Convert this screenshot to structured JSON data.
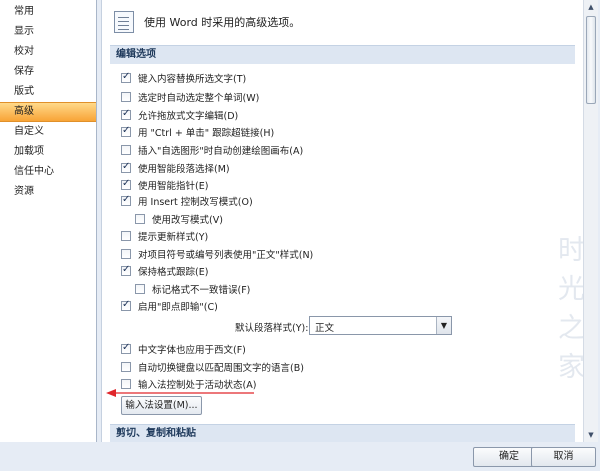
{
  "sidebar": {
    "items": [
      {
        "label": "常用"
      },
      {
        "label": "显示"
      },
      {
        "label": "校对"
      },
      {
        "label": "保存"
      },
      {
        "label": "版式"
      },
      {
        "label": "高级"
      },
      {
        "label": "自定义"
      },
      {
        "label": "加载项"
      },
      {
        "label": "信任中心"
      },
      {
        "label": "资源"
      }
    ],
    "active_index": 5
  },
  "header": {
    "title": "使用 Word 时采用的高级选项。",
    "icon": "document-options-icon"
  },
  "sections": {
    "editing": "编辑选项",
    "cut_copy_paste": "剪切、复制和粘贴"
  },
  "options": [
    {
      "label": "键入内容替换所选文字(T)",
      "checked": true
    },
    {
      "label": "选定时自动选定整个单词(W)",
      "checked": false
    },
    {
      "label": "允许拖放式文字编辑(D)",
      "checked": true
    },
    {
      "label": "用 \"Ctrl + 单击\" 跟踪超链接(H)",
      "checked": true
    },
    {
      "label": "插入\"自选图形\"时自动创建绘图画布(A)",
      "checked": false
    },
    {
      "label": "使用智能段落选择(M)",
      "checked": true
    },
    {
      "label": "使用智能指针(E)",
      "checked": true
    },
    {
      "label": "用 Insert 控制改写模式(O)",
      "checked": true
    },
    {
      "label": "使用改写模式(V)",
      "checked": false
    },
    {
      "label": "提示更新样式(Y)",
      "checked": false
    },
    {
      "label": "对项目符号或编号列表使用\"正文\"样式(N)",
      "checked": false
    },
    {
      "label": "保持格式跟踪(E)",
      "checked": true
    },
    {
      "label": "标记格式不一致错误(F)",
      "checked": false
    },
    {
      "label": "启用\"即点即输\"(C)",
      "checked": true
    },
    {
      "label": "中文字体也应用于西文(F)",
      "checked": true
    },
    {
      "label": "自动切换键盘以匹配周围文字的语言(B)",
      "checked": false
    },
    {
      "label": "输入法控制处于活动状态(A)",
      "checked": false
    }
  ],
  "default_style": {
    "label": "默认段落样式(Y):",
    "value": "正文"
  },
  "ime_button": "输入法设置(M)...",
  "watermark": "时光之家",
  "footer": {
    "ok": "确定",
    "cancel": "取消"
  },
  "colors": {
    "accent": "#f8a437",
    "arrow": "#e0262b",
    "section_bg": "#dde6f2"
  }
}
